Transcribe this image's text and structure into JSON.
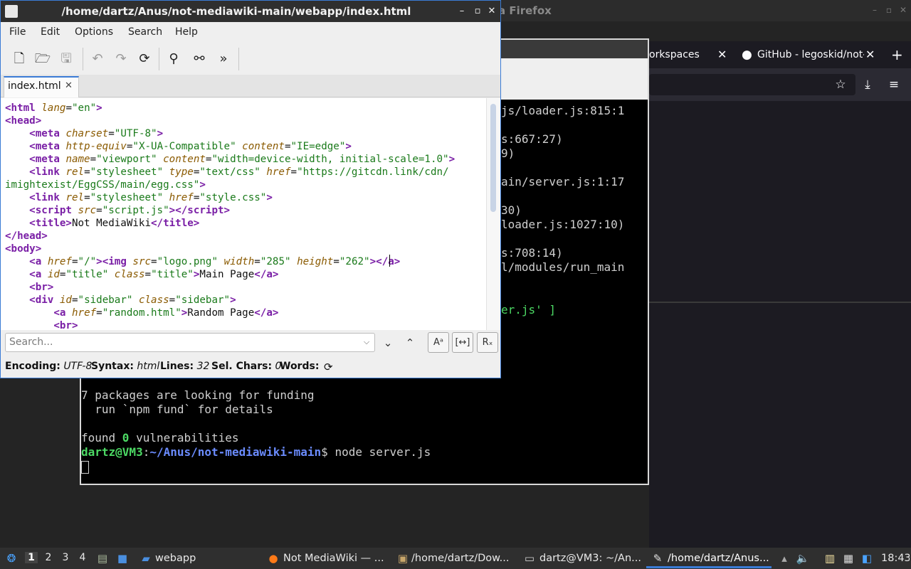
{
  "firefox": {
    "title": "a Firefox",
    "tabs": [
      {
        "label": "orkspaces"
      },
      {
        "label": "GitHub - legoskid/not-m"
      }
    ]
  },
  "terminal": {
    "lines": [
      "js/loader.js:815:1",
      "",
      "s:667:27)",
      "9)",
      "",
      "ain/server.js:1:17",
      "",
      "30)",
      "loader.js:1027:10)",
      "",
      "s:708:14)",
      "l/modules/run_main",
      "",
      "",
      "er.js' ]"
    ],
    "funding_line1": "7 packages are looking for funding",
    "funding_line2": "  run `npm fund` for details",
    "found": "found ",
    "found_count": "0",
    "found_rest": " vulnerabilities",
    "prompt_user": "dartz@VM3",
    "prompt_colon": ":",
    "prompt_path": "~/Anus/not-mediawiki-main",
    "prompt_cmd": "$ node server.js"
  },
  "featherpad": {
    "title": "/home/dartz/Anus/not-mediawiki-main/webapp/index.html",
    "menu": [
      "File",
      "Edit",
      "Options",
      "Search",
      "Help"
    ],
    "tab_label": "index.html",
    "search_placeholder": "Search...",
    "status": {
      "encoding_label": "Encoding:",
      "encoding_value": "UTF-8",
      "syntax_label": "Syntax:",
      "syntax_value": "html",
      "lines_label": "Lines:",
      "lines_value": "32",
      "selchars_label": "Sel. Chars:",
      "selchars_value": "0",
      "words_label": "Words:"
    }
  },
  "taskbar": {
    "desktops": [
      "1",
      "2",
      "3",
      "4"
    ],
    "items": [
      {
        "label": "webapp"
      },
      {
        "label": "Not MediaWiki — ..."
      },
      {
        "label": "/home/dartz/Dow..."
      },
      {
        "label": "dartz@VM3: ~/An..."
      },
      {
        "label": "/home/dartz/Anus..."
      }
    ],
    "clock": "18:43"
  }
}
